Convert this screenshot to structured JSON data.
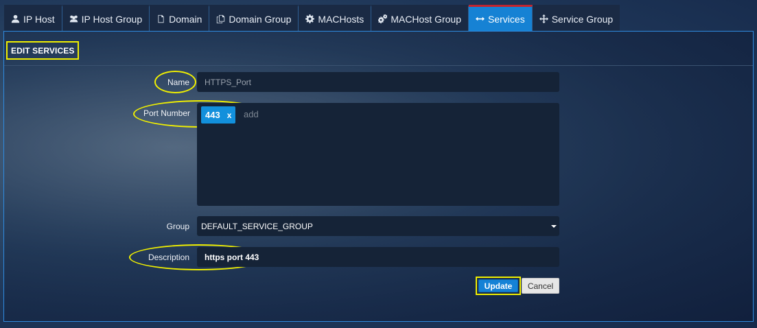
{
  "tabs": [
    {
      "label": "IP Host",
      "icon": "user-icon",
      "active": false
    },
    {
      "label": "IP Host Group",
      "icon": "users-icon",
      "active": false
    },
    {
      "label": "Domain",
      "icon": "document-icon",
      "active": false
    },
    {
      "label": "Domain Group",
      "icon": "documents-icon",
      "active": false
    },
    {
      "label": "MACHosts",
      "icon": "gear-icon",
      "active": false
    },
    {
      "label": "MACHost Group",
      "icon": "gears-icon",
      "active": false
    },
    {
      "label": "Services",
      "icon": "arrows-horizontal-icon",
      "active": true
    },
    {
      "label": "Service Group",
      "icon": "arrows-move-icon",
      "active": false
    }
  ],
  "panel": {
    "title": "EDIT SERVICES"
  },
  "form": {
    "name_label": "Name",
    "name_value": "HTTPS_Port",
    "port_label": "Port Number",
    "port_tags": [
      "443"
    ],
    "port_tag_remove": "x",
    "port_placeholder": "add",
    "group_label": "Group",
    "group_value": "DEFAULT_SERVICE_GROUP",
    "description_label": "Description",
    "description_value": "https port 443"
  },
  "buttons": {
    "update": "Update",
    "cancel": "Cancel"
  },
  "colors": {
    "accent": "#1682d4",
    "active_tab_top": "#c4242c",
    "highlight": "#f1f000",
    "field_bg": "#152337"
  }
}
